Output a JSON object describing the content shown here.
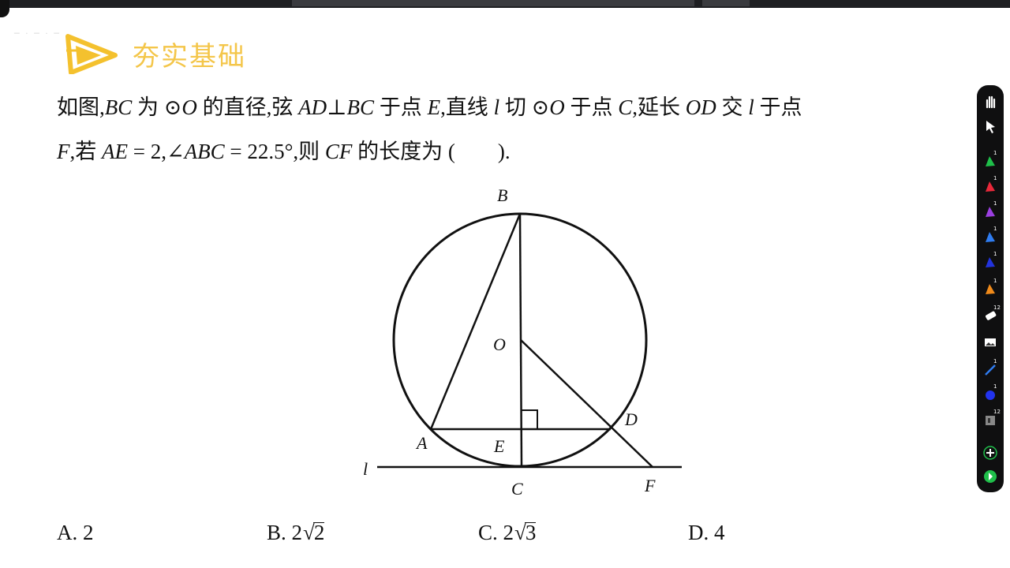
{
  "header": {
    "title": "夯实基础",
    "watermark": "─ · ─ · ─"
  },
  "question": {
    "line1": [
      {
        "t": "如图,",
        "i": false
      },
      {
        "t": "BC",
        "i": true
      },
      {
        "t": " 为 ⊙",
        "i": false
      },
      {
        "t": "O",
        "i": true
      },
      {
        "t": " 的直径,弦 ",
        "i": false
      },
      {
        "t": "AD",
        "i": true
      },
      {
        "t": "⊥",
        "i": false
      },
      {
        "t": "BC",
        "i": true
      },
      {
        "t": " 于点 ",
        "i": false
      },
      {
        "t": "E",
        "i": true
      },
      {
        "t": ",直线 ",
        "i": false
      },
      {
        "t": "l",
        "i": true
      },
      {
        "t": " 切 ⊙",
        "i": false
      },
      {
        "t": "O",
        "i": true
      },
      {
        "t": " 于点 ",
        "i": false
      },
      {
        "t": "C",
        "i": true
      },
      {
        "t": ",延长 ",
        "i": false
      },
      {
        "t": "OD",
        "i": true
      },
      {
        "t": " 交 ",
        "i": false
      },
      {
        "t": "l",
        "i": true
      },
      {
        "t": " 于点",
        "i": false
      }
    ],
    "line2": [
      {
        "t": "F",
        "i": true
      },
      {
        "t": ",若 ",
        "i": false
      },
      {
        "t": "AE",
        "i": true
      },
      {
        "t": " = 2,∠",
        "i": false
      },
      {
        "t": "ABC",
        "i": true
      },
      {
        "t": " = 22.5°,则 ",
        "i": false
      },
      {
        "t": "CF",
        "i": true
      },
      {
        "t": " 的长度为 (　　).",
        "i": false
      }
    ]
  },
  "figure": {
    "labels": {
      "B": "B",
      "O": "O",
      "A": "A",
      "E": "E",
      "D": "D",
      "C": "C",
      "F": "F",
      "l": "l"
    }
  },
  "options": {
    "a": {
      "label": "A. 2"
    },
    "b": {
      "prefix": "B. 2",
      "radicand": "2"
    },
    "c": {
      "prefix": "C. 2",
      "radicand": "3"
    },
    "d": {
      "label": "D. 4"
    }
  },
  "toolbar": {
    "tools": [
      {
        "name": "hand-tool",
        "color": "#ffffff",
        "badge": ""
      },
      {
        "name": "pointer-tool",
        "color": "#ffffff",
        "badge": ""
      },
      {
        "name": "pen-green",
        "color": "#1fbf4a",
        "badge": "1"
      },
      {
        "name": "pen-red",
        "color": "#e8283a",
        "badge": "1"
      },
      {
        "name": "pen-purple",
        "color": "#9b3fe0",
        "badge": "1"
      },
      {
        "name": "pen-blue",
        "color": "#2f7cf0",
        "badge": "1"
      },
      {
        "name": "pen-darkblue",
        "color": "#2233dd",
        "badge": "1"
      },
      {
        "name": "pen-orange",
        "color": "#f08a1a",
        "badge": "1"
      },
      {
        "name": "eraser-tool",
        "color": "#ffffff",
        "badge": "12"
      },
      {
        "name": "image-tool",
        "color": "#ffffff",
        "badge": ""
      },
      {
        "name": "line-tool",
        "color": "#2f7cf0",
        "badge": "1"
      },
      {
        "name": "circle-tool",
        "color": "#2233ee",
        "badge": "1"
      },
      {
        "name": "page-tool",
        "color": "#888888",
        "badge": "12"
      },
      {
        "name": "add-tool",
        "color": "#1fbf4a",
        "badge": ""
      },
      {
        "name": "exit-tool",
        "color": "#1fbf4a",
        "badge": ""
      }
    ]
  }
}
